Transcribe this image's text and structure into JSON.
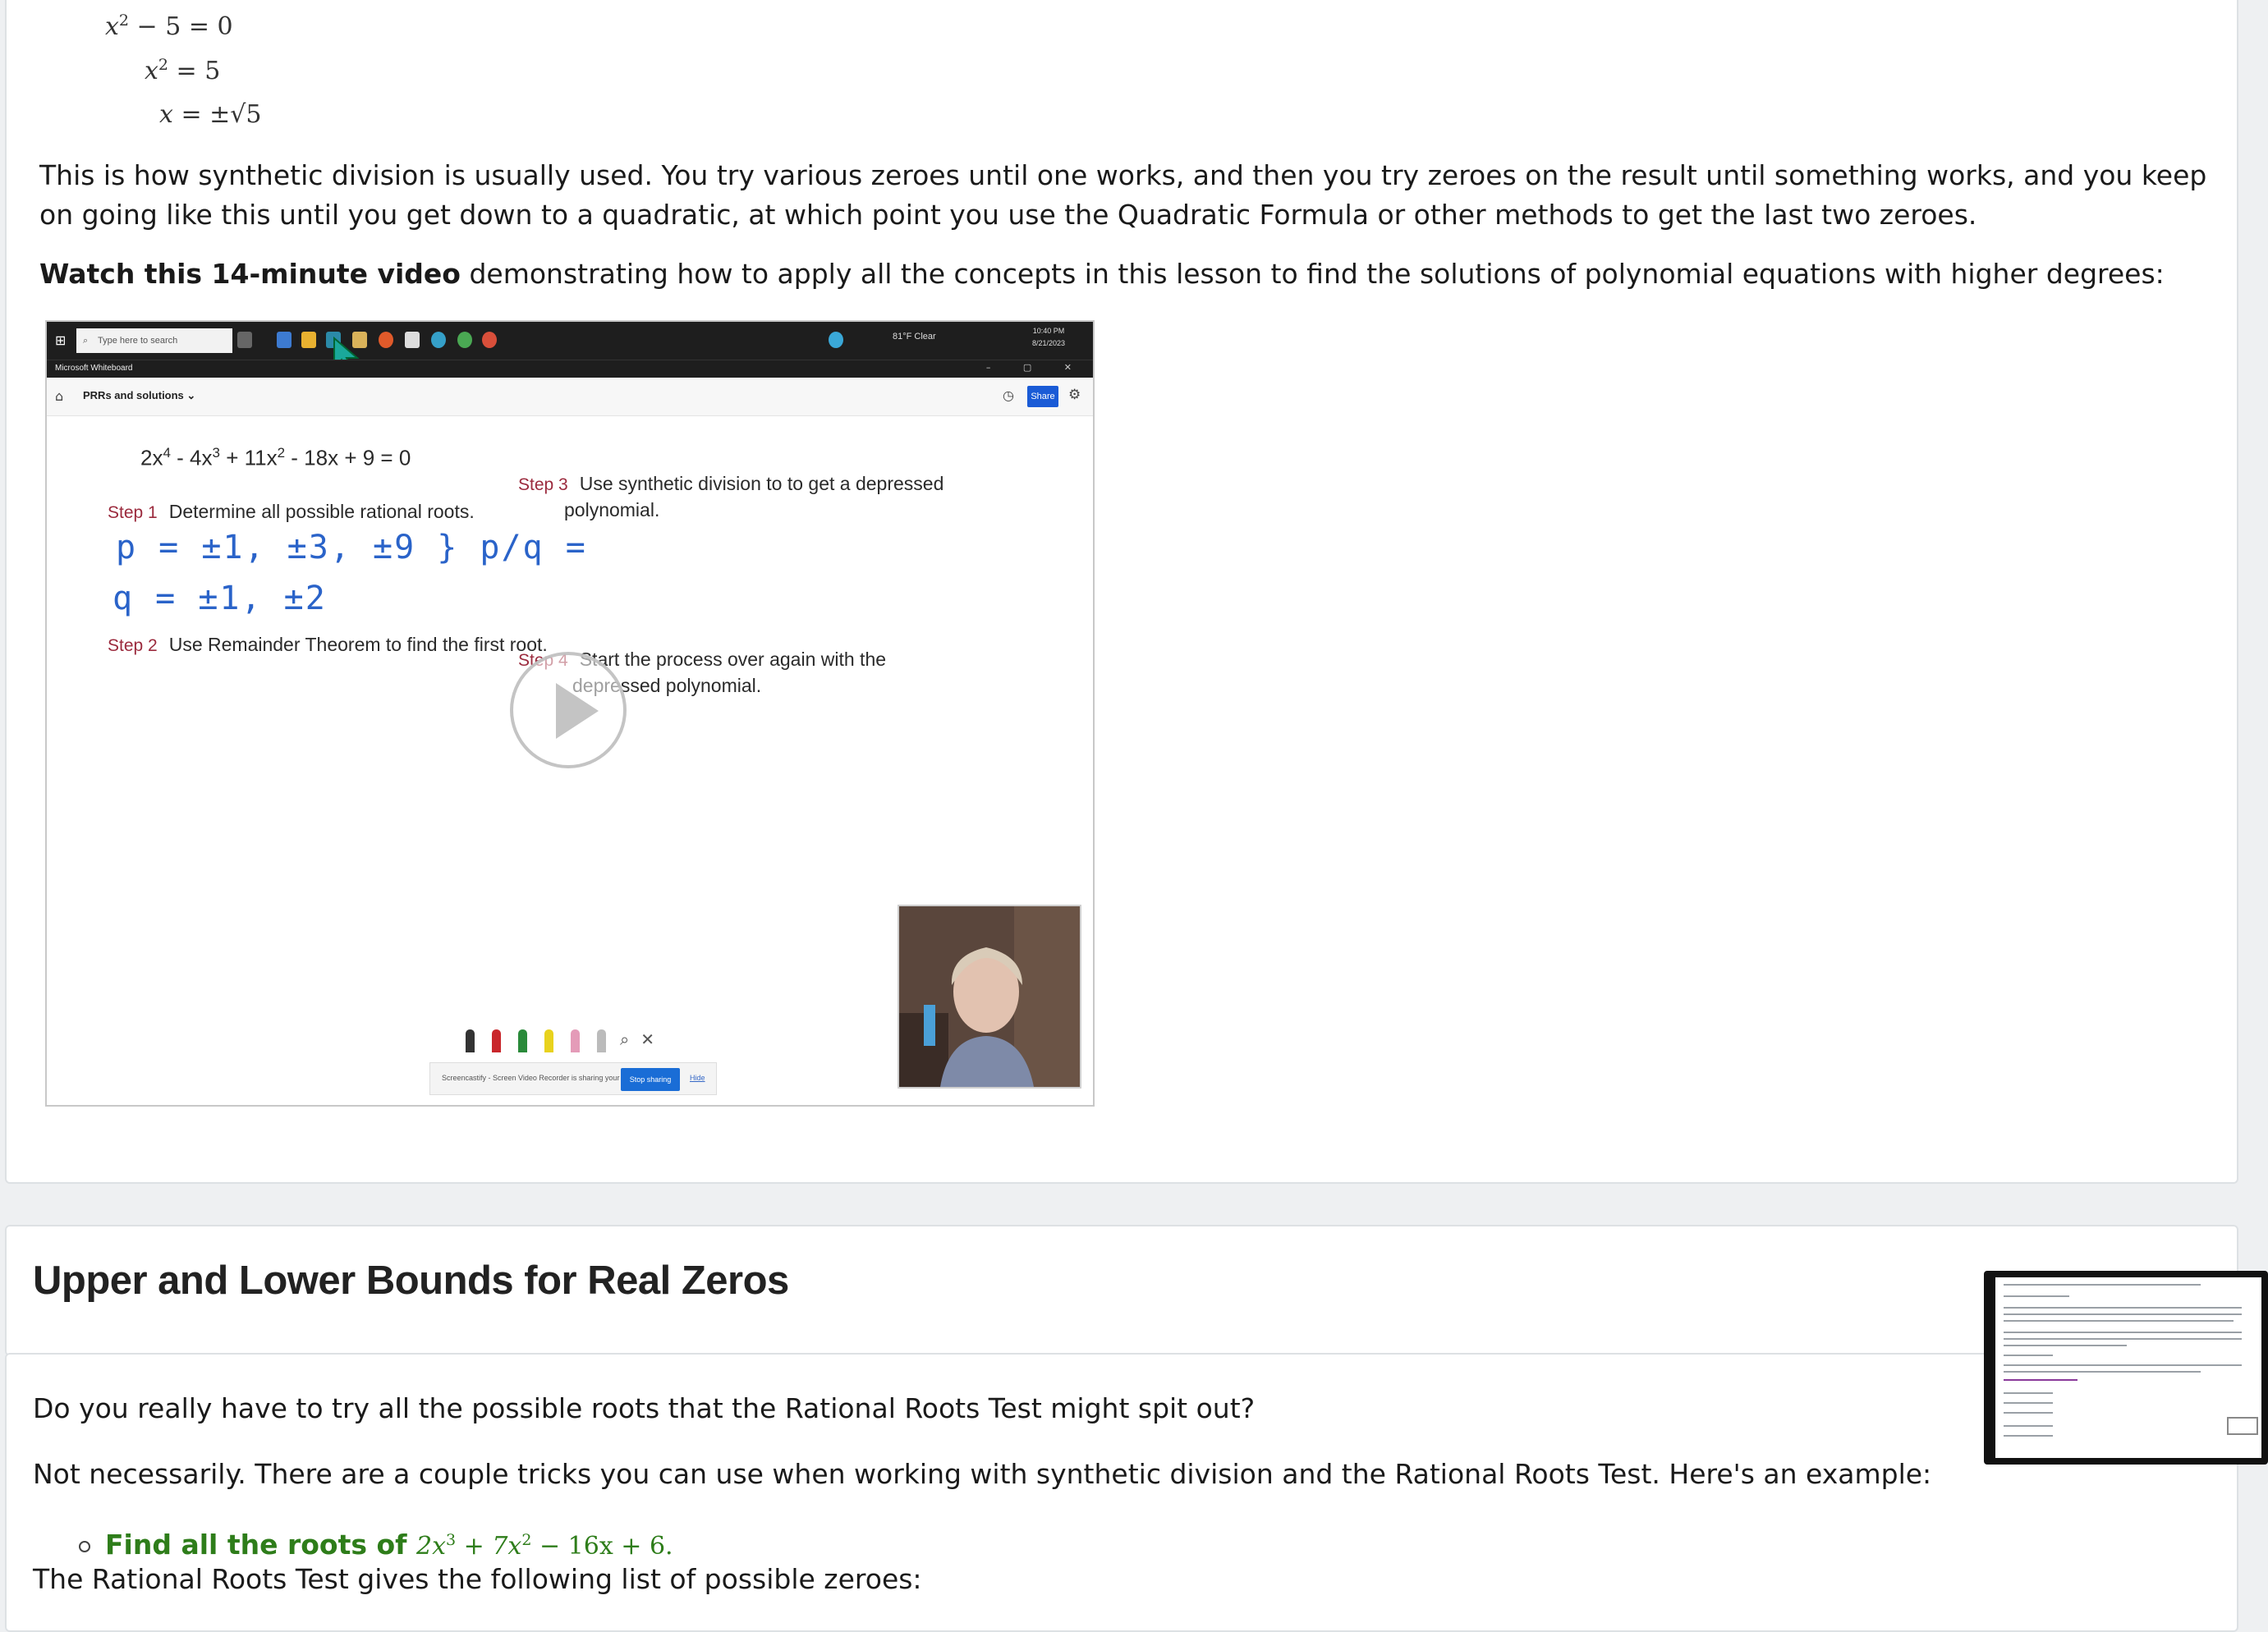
{
  "math_steps": [
    {
      "lhs": "x",
      "exp": "2",
      "rest": " − 5 = 0"
    },
    {
      "lhs": "x",
      "exp": "2",
      "rest": " = 5"
    },
    {
      "lhs": "x",
      "exp": "",
      "rest": " = ±√5"
    }
  ],
  "para_synthetic": "This is how synthetic division is usually used. You try various zeroes until one works, and then you try zeroes on the result until something works, and you keep on going like this until you get down to a quadratic, at which point you use the Quadratic Formula or other methods to get the last two zeroes.",
  "watch": {
    "bold": "Watch this 14-minute video",
    "rest": " demonstrating how to apply all the concepts in this lesson to find the solutions of polynomial equations with higher degrees:"
  },
  "video": {
    "taskbar_search_placeholder": "Type here to search",
    "weather": "81°F  Clear",
    "clock_time": "10:40 PM",
    "clock_date": "8/21/2023",
    "app_title": "Microsoft Whiteboard",
    "board_name": "PRRs and solutions ⌄",
    "share_label": "Share",
    "equation": {
      "a": "2x",
      "e1": "4",
      "b": " - 4x",
      "e2": "3",
      "c": " + 11x",
      "e3": "2",
      "d": " - 18x + 9 = 0"
    },
    "step1_label": "Step 1",
    "step1_text": "Determine all possible rational roots.",
    "step2_label": "Step 2",
    "step2_text": "Use Remainder Theorem to find the first root.",
    "step3_label": "Step 3",
    "step3_text_l1": "Use synthetic division to to get a depressed",
    "step3_text_l2": "polynomial.",
    "step4_label": "Step 4",
    "step4_text_l1": "Start the process over again with the",
    "step4_text_l2": "depressed polynomial.",
    "hand_p": "p = ±1, ±3, ±9 } p/q =",
    "hand_q": "q = ±1, ±2",
    "share_notice": "Screencastify - Screen Video Recorder is sharing your screen.",
    "stop_sharing": "Stop sharing",
    "hide": "Hide"
  },
  "section_heading": "Upper and Lower Bounds for Real Zeros",
  "para_q": "Do you really have to try all the possible roots that the Rational Roots Test might spit out?",
  "para_not": "Not necessarily. There are a couple tricks you can use when working with synthetic division and the Rational Roots Test. Here's an example:",
  "bullet": {
    "label": "Find all the roots of ",
    "expr_a": "2x",
    "e1": "3",
    "expr_b": " + 7x",
    "e2": "2",
    "expr_c": " − 16x + 6."
  },
  "para_rrt": "The Rational Roots Test gives the following list of possible zeroes:",
  "colors": {
    "accent_green": "#2e7d1a",
    "step_red": "#9b2a3d",
    "ink_blue": "#2a63c9",
    "share_blue": "#1a5bd6"
  }
}
